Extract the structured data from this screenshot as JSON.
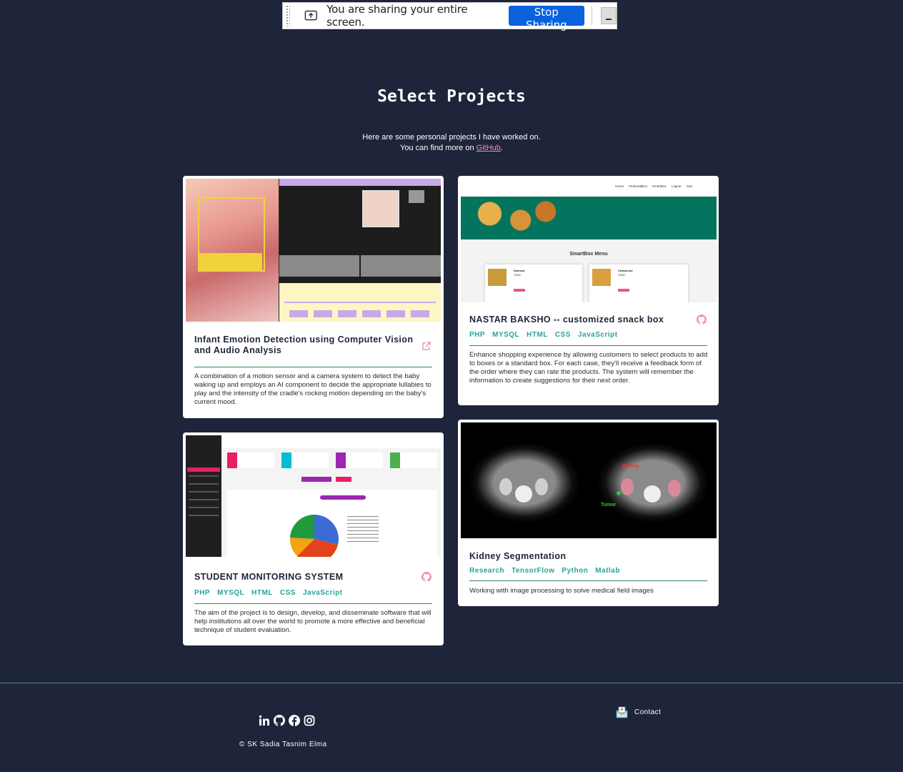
{
  "share_bar": {
    "message": "You are sharing your entire screen.",
    "stop_label": "Stop Sharing"
  },
  "section": {
    "title": "Select Projects",
    "intro_line1": "Here are some personal projects I have worked on.",
    "intro_prefix": "You can find more on ",
    "intro_link": "GitHub",
    "intro_suffix": "."
  },
  "projects": [
    {
      "title": "Infant Emotion Detection using Computer Vision and Audio Analysis",
      "link_icon": "external-link-icon",
      "tags": [],
      "description": "A combination of a motion sensor and a camera system to detect the baby waking up and employs an AI component to decide the appropriate lullabies to play and the intensity of the cradle's rocking motion depending on the baby's current mood."
    },
    {
      "title": "NASTAR BAKSHO -- customized snack box",
      "link_icon": "github-icon",
      "tags": [
        "PHP",
        "MYSQL",
        "HTML",
        "CSS",
        "JavaScript"
      ],
      "description": "Enhance shopping experience by allowing customers to select products to add to boxes or a standard box. For each case, they'll receive a feedback form of the order where they can rate the products. The system will remember the information to create suggestions for their next order.",
      "thumb": {
        "nav": [
          "Home",
          "FeaturedBox",
          "SmartBox",
          "Logout",
          "Cart"
        ],
        "menu_title": "SmartBox Menu",
        "item1": "Samosa",
        "price1": "TK30",
        "item2": "Chanachur",
        "price2": "TK30"
      }
    },
    {
      "title": "STUDENT MONITORING SYSTEM",
      "link_icon": "github-icon",
      "tags": [
        "PHP",
        "MYSQL",
        "HTML",
        "CSS",
        "JavaScript"
      ],
      "description": "The aim of the project is to design, develop, and disseminate software that will help institutions all over the world to promote a more effective and beneficial technique of student evaluation."
    },
    {
      "title": "Kidney Segmentation",
      "link_icon": "",
      "tags": [
        "Research",
        "TensorFlow",
        "Python",
        "Matlab"
      ],
      "description": "Working with image processing to solve medical field images",
      "thumb": {
        "label_kidney": "Kidney",
        "label_tumor": "Tumor"
      }
    }
  ],
  "footer": {
    "social": [
      "linkedin-icon",
      "github-icon",
      "facebook-icon",
      "instagram-icon"
    ],
    "copyright": "© SK Sadia Tasnim Elma",
    "contact": "Contact"
  },
  "colors": {
    "background": "#1e2439",
    "accent_pink": "#f48fb1",
    "tag_teal": "#2aa198",
    "divider_green": "#3a7f5f",
    "stop_blue": "#0a62dd"
  }
}
